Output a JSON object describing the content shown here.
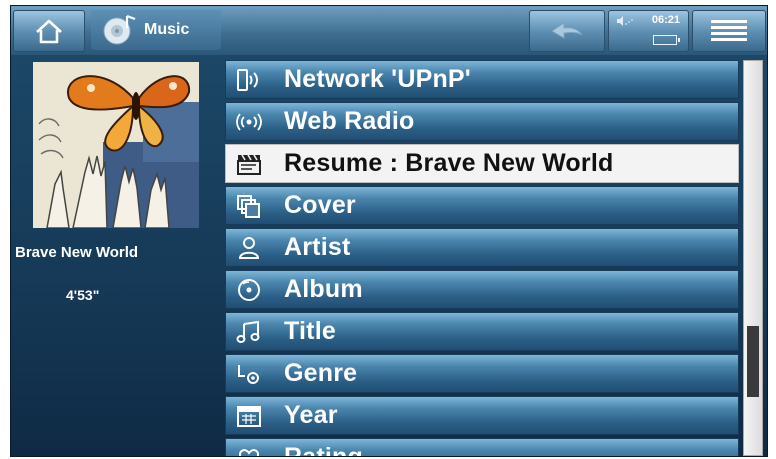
{
  "header": {
    "app_title": "Music",
    "time": "06:21"
  },
  "now_playing": {
    "title": "Brave New World",
    "duration": "4'53\""
  },
  "menu": {
    "items": [
      {
        "label": "Network 'UPnP'",
        "icon": "network-device-icon",
        "selected": false
      },
      {
        "label": "Web Radio",
        "icon": "radio-waves-icon",
        "selected": false
      },
      {
        "label": "Resume : Brave New World",
        "icon": "clapperboard-icon",
        "selected": true
      },
      {
        "label": "Cover",
        "icon": "stacked-covers-icon",
        "selected": false
      },
      {
        "label": "Artist",
        "icon": "person-icon",
        "selected": false
      },
      {
        "label": "Album",
        "icon": "disc-icon",
        "selected": false
      },
      {
        "label": "Title",
        "icon": "music-note-icon",
        "selected": false
      },
      {
        "label": "Genre",
        "icon": "genre-icon",
        "selected": false
      },
      {
        "label": "Year",
        "icon": "calendar-icon",
        "selected": false
      },
      {
        "label": "Rating",
        "icon": "heart-icon",
        "selected": false
      }
    ]
  },
  "scrollbar": {
    "position_fraction": 0.82,
    "visible_fraction": 0.18
  },
  "colors": {
    "row_highlight": "#f3f3f3",
    "row_base": "#2b5f86",
    "header_bar": "#3f6f92"
  }
}
